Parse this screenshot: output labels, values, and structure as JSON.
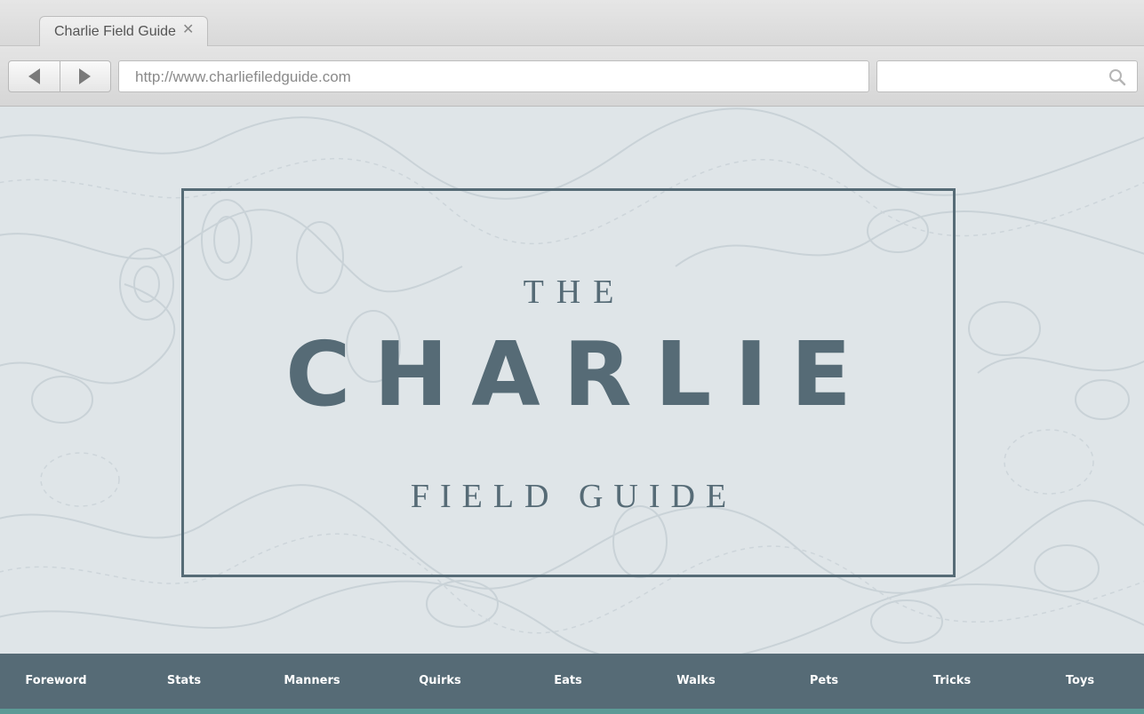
{
  "browser": {
    "tab_title": "Charlie Field Guide",
    "tab_close": "✕",
    "url": "http://www.charliefiledguide.com",
    "search_placeholder": ""
  },
  "hero": {
    "the": "THE",
    "title": "CHARLIE",
    "subtitle": "FIELD GUIDE"
  },
  "nav": {
    "items": [
      "Foreword",
      "Stats",
      "Manners",
      "Quirks",
      "Eats",
      "Walks",
      "Pets",
      "Tricks",
      "Toys"
    ]
  },
  "colors": {
    "background": "#dfe5e8",
    "primary": "#566b76",
    "accent": "#5c9a96",
    "nav_text": "#ffffff"
  },
  "icons": {
    "back": "triangle-left-icon",
    "forward": "triangle-right-icon",
    "search": "magnifier-icon",
    "close": "close-icon"
  }
}
